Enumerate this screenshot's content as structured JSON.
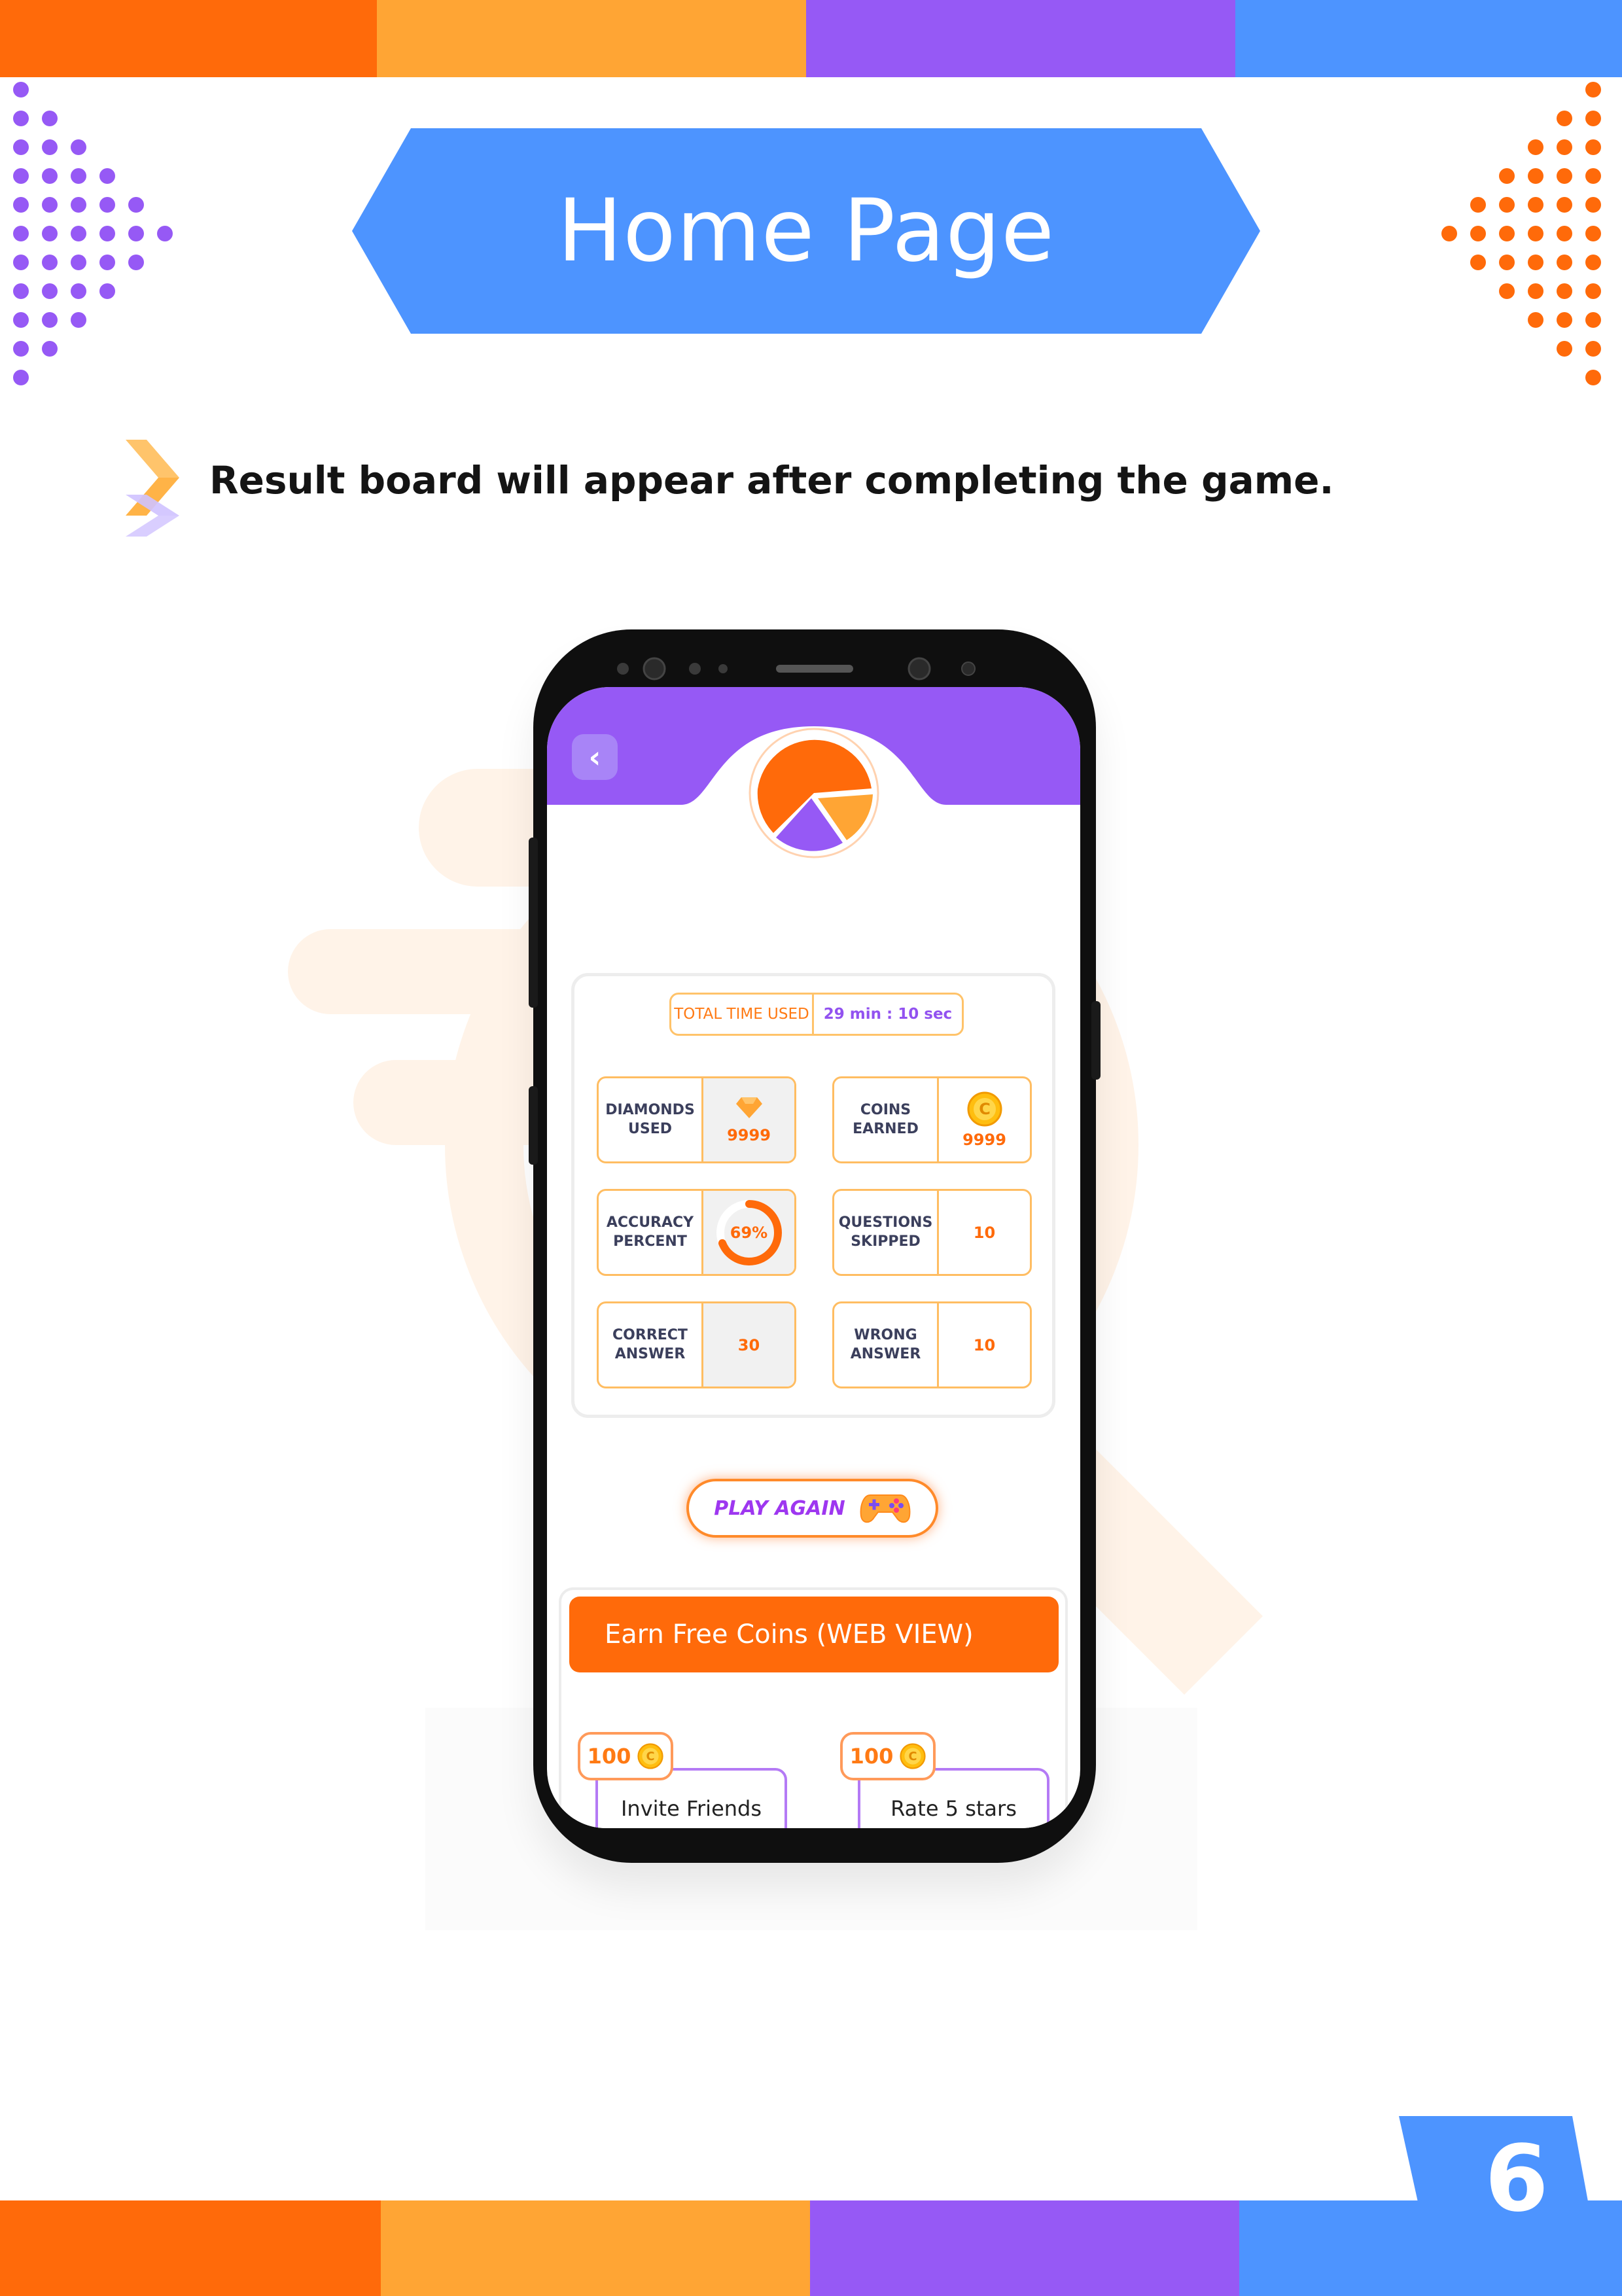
{
  "colors": {
    "orange": "#ff6a0a",
    "yellow": "#ffa534",
    "purple": "#9659f5",
    "blue": "#4d94ff"
  },
  "page": {
    "title": "Home Page",
    "bullet_text": "Result board will appear after completing the game.",
    "page_number": "6"
  },
  "app": {
    "back_icon": "chevron-left-icon",
    "total_time": {
      "label": "TOTAL TIME USED",
      "value": "29 min : 10 sec"
    },
    "stats": {
      "diamonds": {
        "label": "DIAMONDS USED",
        "value": "9999",
        "icon": "diamond-icon"
      },
      "coins": {
        "label": "COINS EARNED",
        "value": "9999",
        "icon": "coin-icon"
      },
      "accuracy": {
        "label": "ACCURACY PERCENT",
        "value": "69%",
        "percent": 69
      },
      "skipped": {
        "label": "QUESTIONS SKIPPED",
        "value": "10"
      },
      "correct": {
        "label": "CORRECT ANSWER",
        "value": "30"
      },
      "wrong": {
        "label": "WRONG ANSWER",
        "value": "10"
      }
    },
    "play_again": {
      "label": "PLAY AGAIN",
      "icon": "gamepad-icon"
    },
    "earn_button": "Earn Free Coins (WEB VIEW)",
    "tasks": [
      {
        "label": "Invite Friends",
        "reward": "100"
      },
      {
        "label": "Rate 5 stars",
        "reward": "100"
      }
    ]
  }
}
